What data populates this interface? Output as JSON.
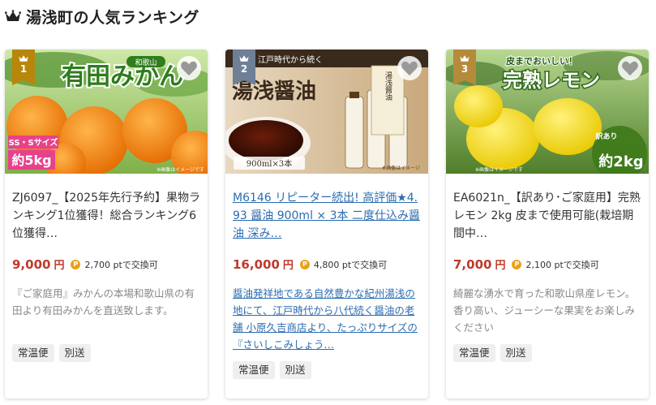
{
  "section": {
    "title": "湯浅町の人気ランキング"
  },
  "colors": {
    "gold": "#b8860b",
    "silver": "#6e7f96",
    "bronze": "#b58a3a",
    "price": "#c0392b",
    "link": "#2b6cb0"
  },
  "cards": [
    {
      "rank": "1",
      "title": "ZJ6097_【2025年先行予約】果物ランキング1位獲得！総合ランキング6位獲得…",
      "price": "9,000",
      "yen": "円",
      "points": "2,700 ptで交換可",
      "description": "『ご家庭用』みかんの本場和歌山県の有田より有田みかんを直送致します。",
      "tags": [
        "常温便",
        "別送"
      ],
      "image": {
        "main_text": "有田みかん",
        "region": "和歌山",
        "size_badge": "SS・Sサイズ",
        "weight_badge": "約5kg",
        "note": "※画像はイメージです"
      }
    },
    {
      "rank": "2",
      "title": "M6146 リピーター続出! 高評価★4.93 醤油 900ml × 3本 二度仕込み醤油 深み…",
      "price": "16,000",
      "yen": "円",
      "points": "4,800 ptで交換可",
      "description": "醤油発祥地である自然豊かな紀州湯浅の地にて、江戸時代から八代続く醤油の老舗 小原久吉商店より、たっぷりサイズの『さいしこみしょう…",
      "tags": [
        "常温便",
        "別送"
      ],
      "image": {
        "top_text": "江戸時代から続く",
        "main_text": "湯浅醤油",
        "bottle_label": "湯浅醤油",
        "size_text": "900ml×3本",
        "note": "※画像はイメージ"
      }
    },
    {
      "rank": "3",
      "title": "EA6021n_【訳あり･ご家庭用】完熟 レモン 2kg 皮まで使用可能(栽培期間中…",
      "price": "7,000",
      "yen": "円",
      "points": "2,100 ptで交換可",
      "description": "綺麗な湧水で育った和歌山県産レモン。香り高い、ジューシーな果実をお楽しみください",
      "tags": [
        "常温便",
        "別送"
      ],
      "image": {
        "top_text": "皮までおいしい！",
        "main_text": "完熟レモン",
        "badge_small": "訳あり",
        "badge_main": "約2kg",
        "note": "※画像はイメージです"
      }
    }
  ]
}
